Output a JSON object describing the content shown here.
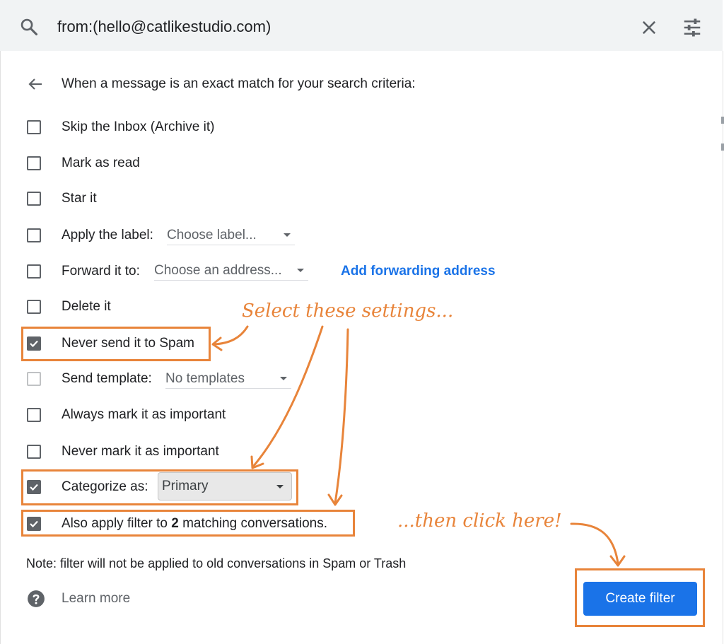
{
  "search": {
    "query": "from:(hello@catlikestudio.com)",
    "icons": {
      "search": "search-icon",
      "close": "close-icon",
      "options": "tune-icon"
    }
  },
  "filter": {
    "header": "When a message is an exact match for your search criteria:",
    "options": {
      "skip_inbox": {
        "label": "Skip the Inbox (Archive it)",
        "checked": false
      },
      "mark_read": {
        "label": "Mark as read",
        "checked": false
      },
      "star": {
        "label": "Star it",
        "checked": false
      },
      "apply_label": {
        "label": "Apply the label:",
        "value": "Choose label...",
        "checked": false
      },
      "forward": {
        "label": "Forward it to:",
        "value": "Choose an address...",
        "checked": false,
        "link": "Add forwarding address"
      },
      "delete": {
        "label": "Delete it",
        "checked": false
      },
      "never_spam": {
        "label": "Never send it to Spam",
        "checked": true
      },
      "send_template": {
        "label": "Send template:",
        "value": "No templates",
        "checked": false,
        "disabled": true
      },
      "always_important": {
        "label": "Always mark it as important",
        "checked": false
      },
      "never_important": {
        "label": "Never mark it as important",
        "checked": false
      },
      "categorize": {
        "label": "Categorize as:",
        "value": "Primary",
        "checked": true
      },
      "also_apply": {
        "label_prefix": "Also apply filter to",
        "count": "2",
        "label_suffix": "matching conversations.",
        "checked": true
      }
    },
    "note": "Note: filter will not be applied to old conversations in Spam or Trash",
    "learn_more": "Learn more",
    "create_button": "Create filter"
  },
  "annotations": {
    "select_settings": "Select these settings...",
    "click_here": "...then click here!",
    "color": "#e8843a"
  },
  "colors": {
    "accent": "#1a73e8",
    "annotation": "#e8843a"
  }
}
